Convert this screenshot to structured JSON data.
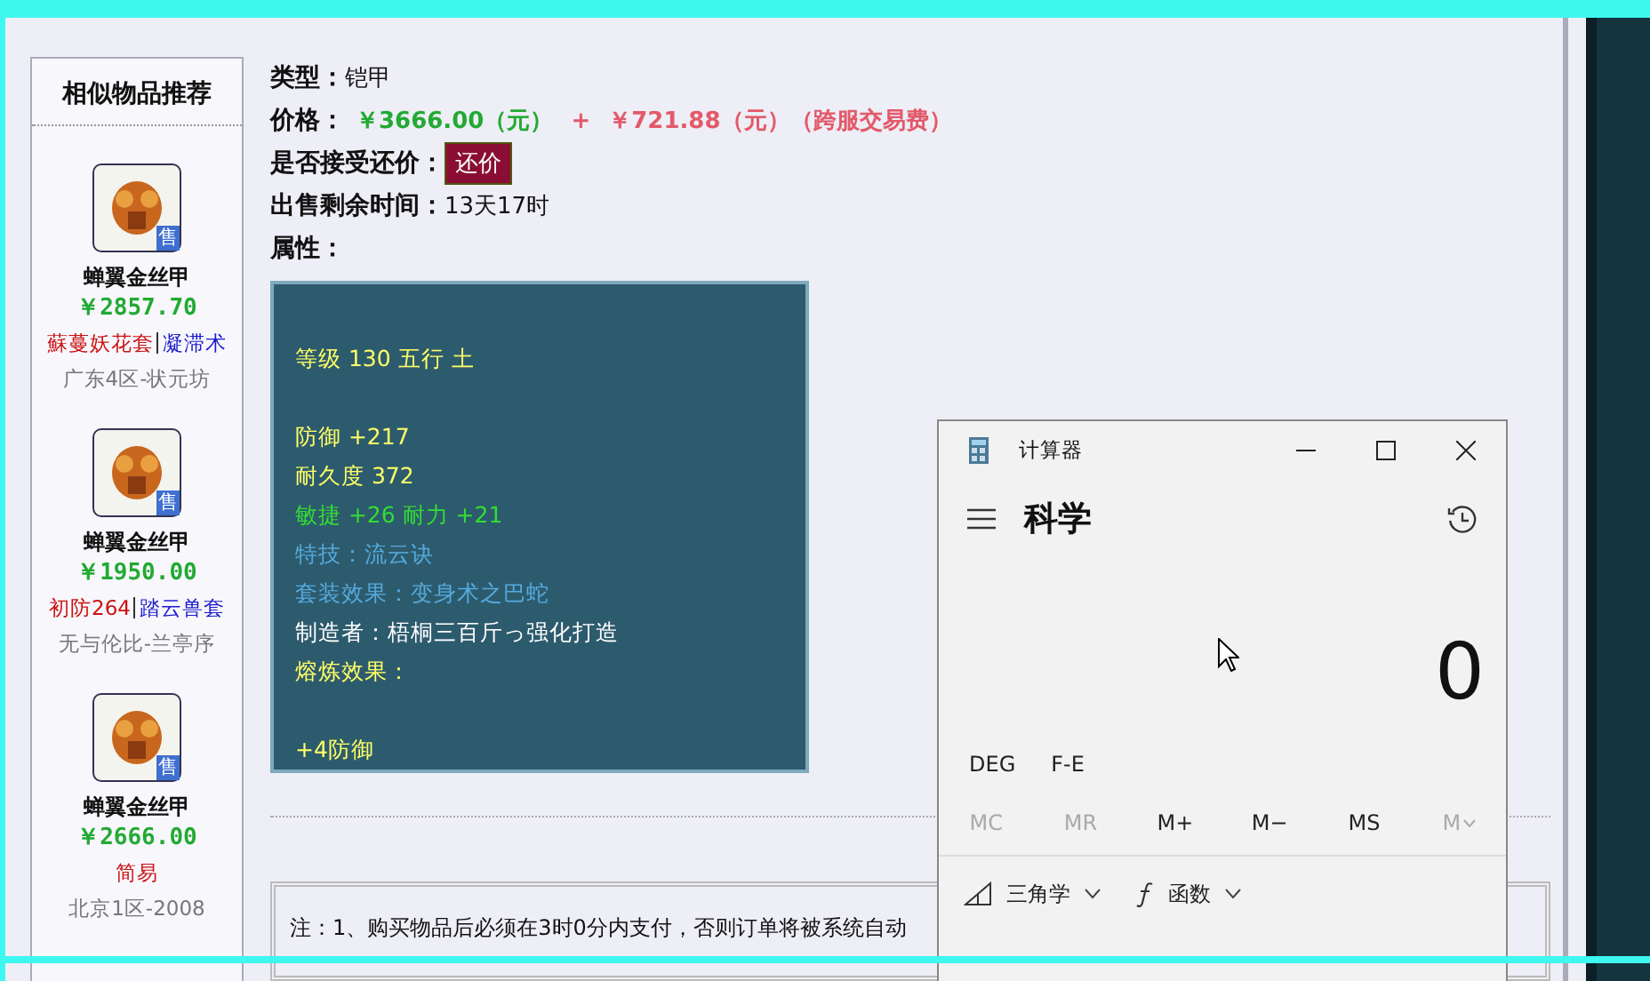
{
  "sidebar": {
    "title": "相似物品推荐",
    "items": [
      {
        "badge": "售",
        "name": "蝉翼金丝甲",
        "price": "￥2857.70",
        "tags": [
          {
            "text": "蘇蔓妖花套",
            "color": "#cc1111"
          },
          {
            "text": "凝滞术",
            "color": "#1a1acc"
          }
        ],
        "server": "广东4区-状元坊"
      },
      {
        "badge": "售",
        "name": "蝉翼金丝甲",
        "price": "￥1950.00",
        "tags": [
          {
            "text": "初防264",
            "color": "#cc1111"
          },
          {
            "text": "踏云兽套",
            "color": "#1a1acc"
          }
        ],
        "server": "无与伦比-兰亭序"
      },
      {
        "badge": "售",
        "name": "蝉翼金丝甲",
        "price": "￥2666.00",
        "tags": [
          {
            "text": "简易",
            "color": "#cc1111"
          }
        ],
        "server": "北京1区-2008"
      }
    ]
  },
  "detail": {
    "type_label": "类型：",
    "type_value": "铠甲",
    "price_label": "价格：",
    "price": "￥3666.00（元）",
    "plus": "+",
    "fee": "￥721.88（元）（跨服交易费）",
    "bargain_label": "是否接受还价：",
    "bargain_button": "还价",
    "time_label": "出售剩余时间：",
    "time_value": "13天17时",
    "attr_label": "属性：",
    "stats": [
      {
        "text": "等级 130 五行 土",
        "color": "#ffff66",
        "space_before": false
      },
      {
        "text": "防御 +217",
        "color": "#ffff66",
        "space_before": true
      },
      {
        "text": "耐久度 372",
        "color": "#ffff66",
        "space_before": false
      },
      {
        "text": "敏捷 +26 耐力 +21",
        "color": "#33dd33",
        "space_before": false
      },
      {
        "text": "特技：流云诀",
        "color": "#55aadd",
        "space_before": false
      },
      {
        "text": "套装效果：变身术之巴蛇",
        "color": "#55aadd",
        "space_before": false
      },
      {
        "text": "制造者：梧桐三百斤っ强化打造",
        "color": "#ffffff",
        "space_before": false
      },
      {
        "text": "熔炼效果：",
        "color": "#ffff66",
        "space_before": false
      },
      {
        "text": "+4防御",
        "color": "#ffff66",
        "space_before": true
      }
    ],
    "note": "注：1、购买物品后必须在3时0分内支付，否则订单将被系统自动"
  },
  "calculator": {
    "title": "计算器",
    "mode": "科学",
    "display": "0",
    "options": [
      "DEG",
      "F-E"
    ],
    "memory": [
      {
        "label": "MC",
        "disabled": true
      },
      {
        "label": "MR",
        "disabled": true
      },
      {
        "label": "M+",
        "disabled": false
      },
      {
        "label": "M−",
        "disabled": false
      },
      {
        "label": "MS",
        "disabled": false
      },
      {
        "label": "M",
        "disabled": true
      }
    ],
    "menus": [
      "三角学",
      "函数"
    ]
  }
}
